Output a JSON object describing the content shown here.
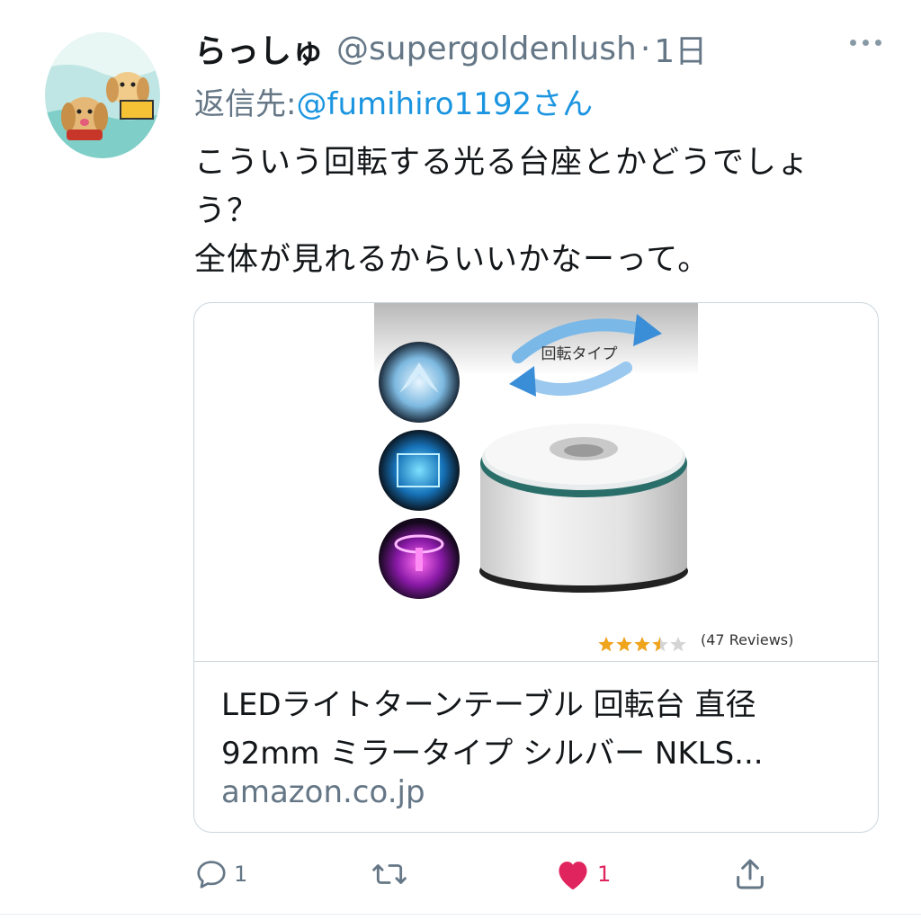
{
  "tweet": {
    "display_name": "らっしゅ",
    "handle": "@supergoldenlush",
    "separator": "·",
    "time": "1日",
    "reply_prefix": "返信先: ",
    "reply_to": "@fumihiro1192さん",
    "text_lines": [
      "こういう回転する光る台座とかどうでしょ",
      "う？",
      "全体が見れるからいいかなーって。"
    ]
  },
  "card": {
    "image_label": "回転タイプ",
    "review_text": "(47 Reviews)",
    "rating": 3.5,
    "rating_max": 5,
    "title_lines": [
      "LEDライトターンテーブル 回転台 直径",
      "92mm ミラータイプ シルバー NKLS..."
    ],
    "domain": "amazon.co.jp"
  },
  "actions": {
    "reply_count": "1",
    "retweet_count": "",
    "like_count": "1"
  },
  "colors": {
    "link": "#1b95e0",
    "secondary": "#657786",
    "like": "#e0245e",
    "star": "#f0a41c"
  }
}
